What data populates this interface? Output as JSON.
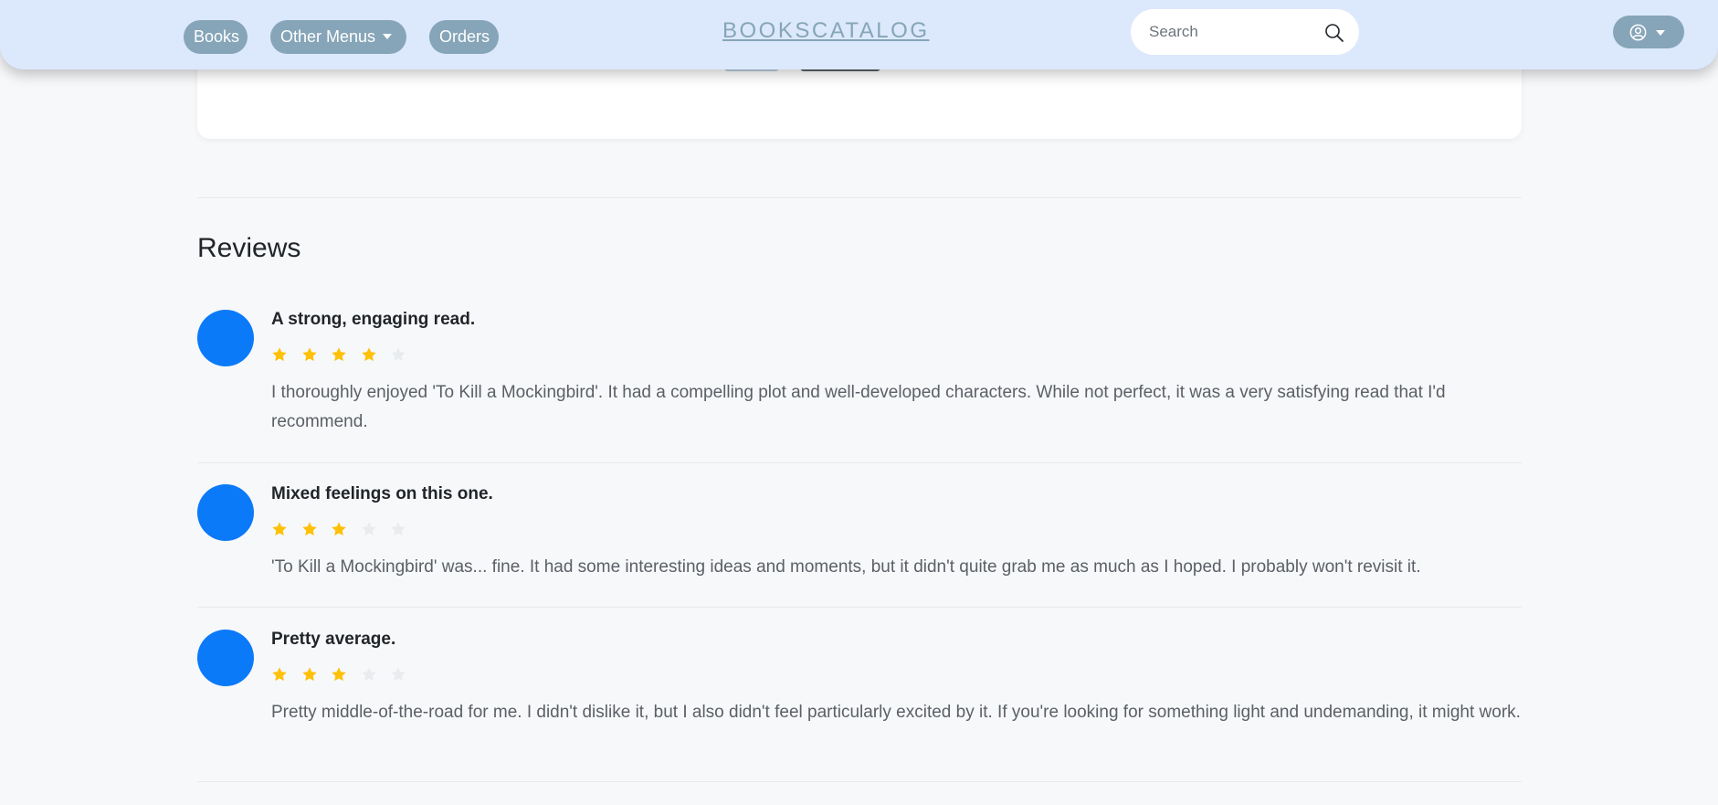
{
  "nav": {
    "books": "Books",
    "other_menus": "Other Menus",
    "orders": "Orders",
    "brand": "BOOKSCATALOG",
    "search_placeholder": "Search"
  },
  "colors": {
    "navbar_bg": "#dce8fc",
    "pill": "#86a5b8",
    "avatar": "#0b7af8",
    "star_filled": "#ffc107",
    "star_empty": "#e9ecef"
  },
  "reviews_heading": "Reviews",
  "reviews": [
    {
      "title": "A strong, engaging read.",
      "rating": 4,
      "max_rating": 5,
      "text": "I thoroughly enjoyed 'To Kill a Mockingbird'. It had a compelling plot and well-developed characters. While not perfect, it was a very satisfying read that I'd recommend."
    },
    {
      "title": "Mixed feelings on this one.",
      "rating": 3,
      "max_rating": 5,
      "text": "'To Kill a Mockingbird' was... fine. It had some interesting ideas and moments, but it didn't quite grab me as much as I hoped. I probably won't revisit it."
    },
    {
      "title": "Pretty average.",
      "rating": 3,
      "max_rating": 5,
      "text": "Pretty middle-of-the-road for me. I didn't dislike it, but I also didn't feel particularly excited by it. If you're looking for something light and undemanding, it might work."
    }
  ]
}
